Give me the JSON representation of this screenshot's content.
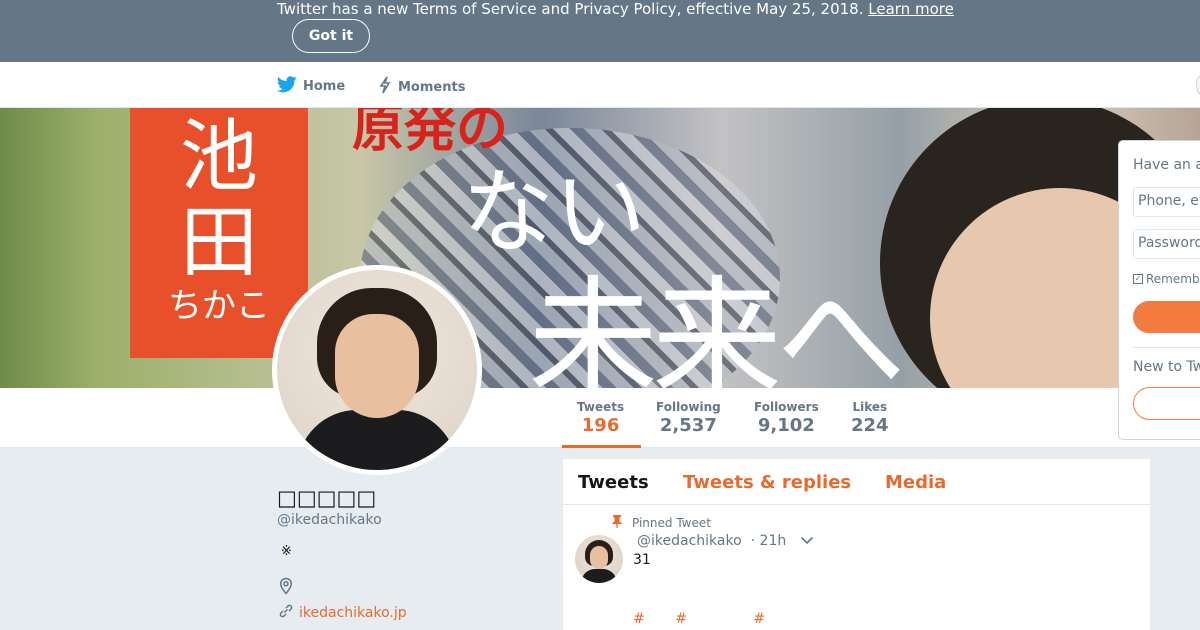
{
  "banner": {
    "text": "Twitter has a new Terms of Service and Privacy Policy, effective May 25, 2018.",
    "link": "Learn more",
    "button": "Got it"
  },
  "nav": {
    "home": "Home",
    "moments": "Moments"
  },
  "cover": {
    "name_top": "池",
    "name_mid": "田",
    "name_bottom": "ちかこ",
    "slogan_red": "原発の",
    "slogan_line1": "ない",
    "slogan_line2": "未来へ"
  },
  "stats": [
    {
      "label": "Tweets",
      "value": "196"
    },
    {
      "label": "Following",
      "value": "2,537"
    },
    {
      "label": "Followers",
      "value": "9,102"
    },
    {
      "label": "Likes",
      "value": "224"
    }
  ],
  "profile": {
    "name": "□□□□□",
    "handle": "@ikedachikako",
    "bio": "※",
    "url": "ikedachikako.jp"
  },
  "timeline": {
    "tabs": [
      "Tweets",
      "Tweets & replies",
      "Media"
    ],
    "pinned_label": "Pinned Tweet",
    "tweet": {
      "handle": "@ikedachikako",
      "time": "· 21h",
      "text": "31",
      "hashtags": [
        "#",
        "#",
        "#"
      ]
    }
  },
  "login": {
    "title": "Have an account?",
    "phone_placeholder": "Phone, email or username",
    "password_placeholder": "Password",
    "remember": "Remember me",
    "new_to": "New to Twitter?"
  },
  "colors": {
    "accent": "#e66b2f",
    "banner_bg": "#657786",
    "page_bg": "#e6ecf0"
  }
}
